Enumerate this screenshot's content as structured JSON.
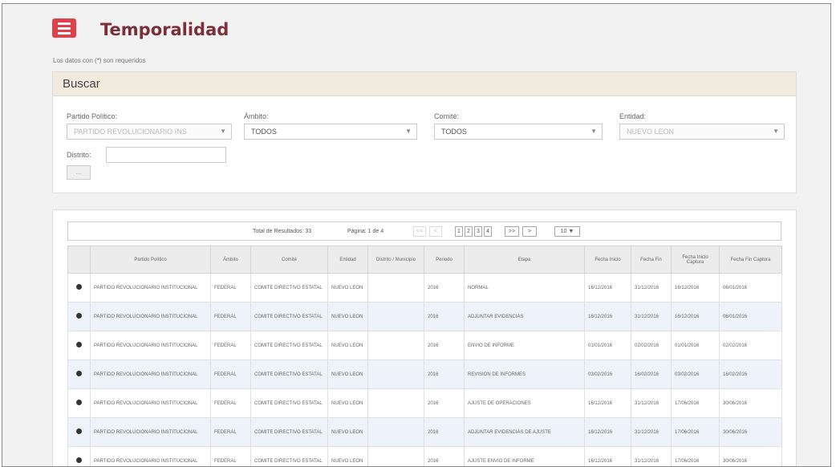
{
  "header": {
    "title": "Temporalidad",
    "required_note": "Los datos con (*) son requeridos"
  },
  "search": {
    "title": "Buscar",
    "partido": {
      "label": "Partido Político:",
      "value": "PARTIDO REVOLUCIONARIO INS"
    },
    "ambito": {
      "label": "Ámbito:",
      "value": "TODOS"
    },
    "comite": {
      "label": "Comité:",
      "value": "TODOS"
    },
    "entidad": {
      "label": "Entidad:",
      "value": "NUEVO LEON"
    },
    "distrito": {
      "label": "Distrito:",
      "value": ""
    },
    "button_label": "..."
  },
  "pager": {
    "total_text": "Total de Resultados: 33",
    "page_text": "Página: 1 de 4",
    "prev_buttons": [
      "<<",
      "<"
    ],
    "pages": [
      "1",
      "2",
      "3",
      "4"
    ],
    "next_buttons": [
      ">>",
      ">"
    ],
    "page_size": "10"
  },
  "table": {
    "columns": [
      "",
      "Partido Político",
      "Ámbito",
      "Comité",
      "Entidad",
      "Distrito / Municipio",
      "Periodo",
      "Etapa",
      "Fecha Inicio",
      "Fecha Fin",
      "Fecha Inicio Captura",
      "Fecha Fin Captura"
    ],
    "rows": [
      {
        "partido": "PARTIDO REVOLUCIONARIO INSTITUCIONAL",
        "ambito": "FEDERAL",
        "comite": "COMITE DIRECTIVO ESTATAL",
        "entidad": "NUEVO LEON",
        "distrito": "",
        "periodo": "2016",
        "etapa": "NORMAL",
        "inicio": "16/12/2016",
        "fin": "31/12/2016",
        "inicio_captura": "16/12/2016",
        "fin_captura": "06/01/2016"
      },
      {
        "partido": "PARTIDO REVOLUCIONARIO INSTITUCIONAL",
        "ambito": "FEDERAL",
        "comite": "COMITE DIRECTIVO ESTATAL",
        "entidad": "NUEVO LEON",
        "distrito": "",
        "periodo": "2016",
        "etapa": "ADJUNTAR EVIDENCIAS",
        "inicio": "16/12/2016",
        "fin": "31/12/2016",
        "inicio_captura": "16/12/2016",
        "fin_captura": "06/01/2016"
      },
      {
        "partido": "PARTIDO REVOLUCIONARIO INSTITUCIONAL",
        "ambito": "FEDERAL",
        "comite": "COMITE DIRECTIVO ESTATAL",
        "entidad": "NUEVO LEON",
        "distrito": "",
        "periodo": "2016",
        "etapa": "ENVIO DE INFORME",
        "inicio": "01/01/2016",
        "fin": "02/02/2016",
        "inicio_captura": "01/01/2016",
        "fin_captura": "02/02/2016"
      },
      {
        "partido": "PARTIDO REVOLUCIONARIO INSTITUCIONAL",
        "ambito": "FEDERAL",
        "comite": "COMITE DIRECTIVO ESTATAL",
        "entidad": "NUEVO LEON",
        "distrito": "",
        "periodo": "2016",
        "etapa": "REVISION DE INFORMES",
        "inicio": "03/02/2016",
        "fin": "16/02/2016",
        "inicio_captura": "03/02/2016",
        "fin_captura": "16/02/2016"
      },
      {
        "partido": "PARTIDO REVOLUCIONARIO INSTITUCIONAL",
        "ambito": "FEDERAL",
        "comite": "COMITE DIRECTIVO ESTATAL",
        "entidad": "NUEVO LEON",
        "distrito": "",
        "periodo": "2016",
        "etapa": "AJUSTE DE OPERACIONES",
        "inicio": "16/12/2016",
        "fin": "31/12/2016",
        "inicio_captura": "17/06/2016",
        "fin_captura": "30/06/2016"
      },
      {
        "partido": "PARTIDO REVOLUCIONARIO INSTITUCIONAL",
        "ambito": "FEDERAL",
        "comite": "COMITE DIRECTIVO ESTATAL",
        "entidad": "NUEVO LEON",
        "distrito": "",
        "periodo": "2016",
        "etapa": "ADJUNTAR EVIDENCIAS DE AJUSTE",
        "inicio": "16/12/2016",
        "fin": "31/12/2016",
        "inicio_captura": "17/06/2016",
        "fin_captura": "30/06/2016"
      },
      {
        "partido": "PARTIDO REVOLUCIONARIO INSTITUCIONAL",
        "ambito": "FEDERAL",
        "comite": "COMITE DIRECTIVO ESTATAL",
        "entidad": "NUEVO LEON",
        "distrito": "",
        "periodo": "2016",
        "etapa": "AJUSTE ENVIO DE INFORME",
        "inicio": "16/12/2016",
        "fin": "31/12/2016",
        "inicio_captura": "17/06/2016",
        "fin_captura": "30/06/2016"
      }
    ]
  },
  "colors": {
    "accent": "#e0404a",
    "title": "#7a2f3b",
    "panel_header": "#f1ebdf",
    "row_alt": "#eef2fa"
  }
}
